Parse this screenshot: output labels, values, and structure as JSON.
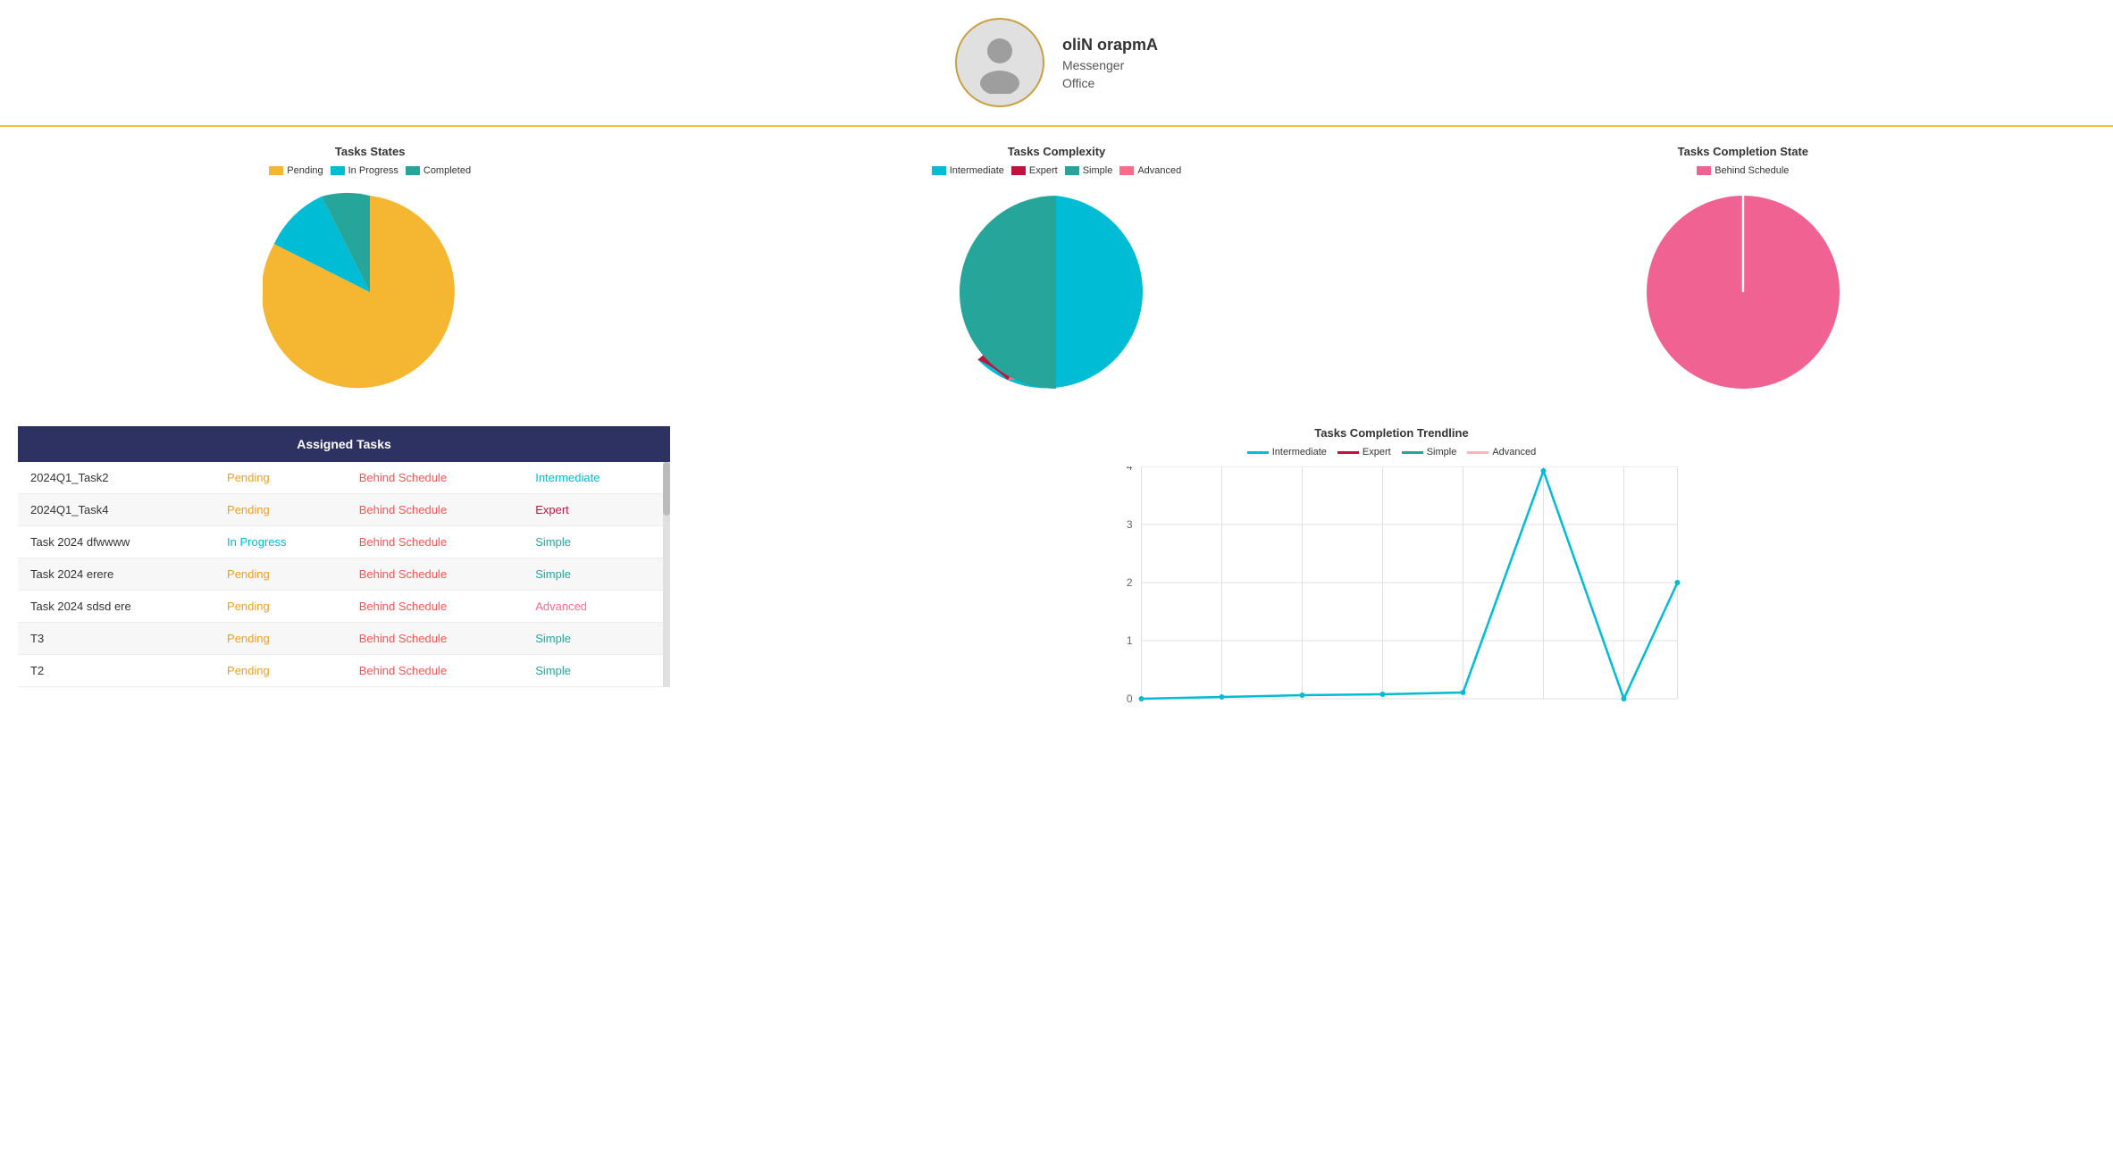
{
  "header": {
    "user_name": "oliN orapmA",
    "user_role": "Messenger",
    "user_dept": "Office"
  },
  "charts": {
    "tasks_states": {
      "title": "Tasks States",
      "legend": [
        {
          "label": "Pending",
          "color": "#f5b731"
        },
        {
          "label": "In Progress",
          "color": "#00bcd4"
        },
        {
          "label": "Completed",
          "color": "#26a69a"
        }
      ]
    },
    "tasks_complexity": {
      "title": "Tasks Complexity",
      "legend": [
        {
          "label": "Intermediate",
          "color": "#00bcd4"
        },
        {
          "label": "Expert",
          "color": "#c0143c"
        },
        {
          "label": "Simple",
          "color": "#26a69a"
        },
        {
          "label": "Advanced",
          "color": "#ff6b8a"
        }
      ]
    },
    "tasks_completion_state": {
      "title": "Tasks Completion State",
      "legend": [
        {
          "label": "Behind Schedule",
          "color": "#f06292"
        }
      ]
    }
  },
  "table": {
    "title": "Assigned Tasks",
    "rows": [
      {
        "name": "2024Q1_Task2",
        "status": "Pending",
        "completion": "Behind Schedule",
        "complexity": "Intermediate"
      },
      {
        "name": "2024Q1_Task4",
        "status": "Pending",
        "completion": "Behind Schedule",
        "complexity": "Expert"
      },
      {
        "name": "Task 2024 dfwwww",
        "status": "In Progress",
        "completion": "Behind Schedule",
        "complexity": "Simple"
      },
      {
        "name": "Task 2024 erere",
        "status": "Pending",
        "completion": "Behind Schedule",
        "complexity": "Simple"
      },
      {
        "name": "Task 2024 sdsd ere",
        "status": "Pending",
        "completion": "Behind Schedule",
        "complexity": "Advanced"
      },
      {
        "name": "T3",
        "status": "Pending",
        "completion": "Behind Schedule",
        "complexity": "Simple"
      },
      {
        "name": "T2",
        "status": "Pending",
        "completion": "Behind Schedule",
        "complexity": "Simple"
      }
    ]
  },
  "trendline": {
    "title": "Tasks Completion Trendline",
    "legend": [
      {
        "label": "Intermediate",
        "color": "#00bcd4"
      },
      {
        "label": "Expert",
        "color": "#c0143c"
      },
      {
        "label": "Simple",
        "color": "#26a69a"
      },
      {
        "label": "Advanced",
        "color": "#ffb3c1"
      }
    ],
    "y_labels": [
      "0",
      "1",
      "2",
      "3",
      "4"
    ],
    "x_labels": [
      "",
      "",
      "",
      "",
      "",
      "",
      "",
      ""
    ]
  },
  "colors": {
    "pending": "#f0a020",
    "inprogress": "#00bcd4",
    "behind": "#ff5252",
    "intermediate": "#00bcd4",
    "expert": "#c0143c",
    "simple": "#26a69a",
    "advanced": "#ff6b8a",
    "table_header_bg": "#2d3263",
    "table_header_text": "#ffffff"
  }
}
